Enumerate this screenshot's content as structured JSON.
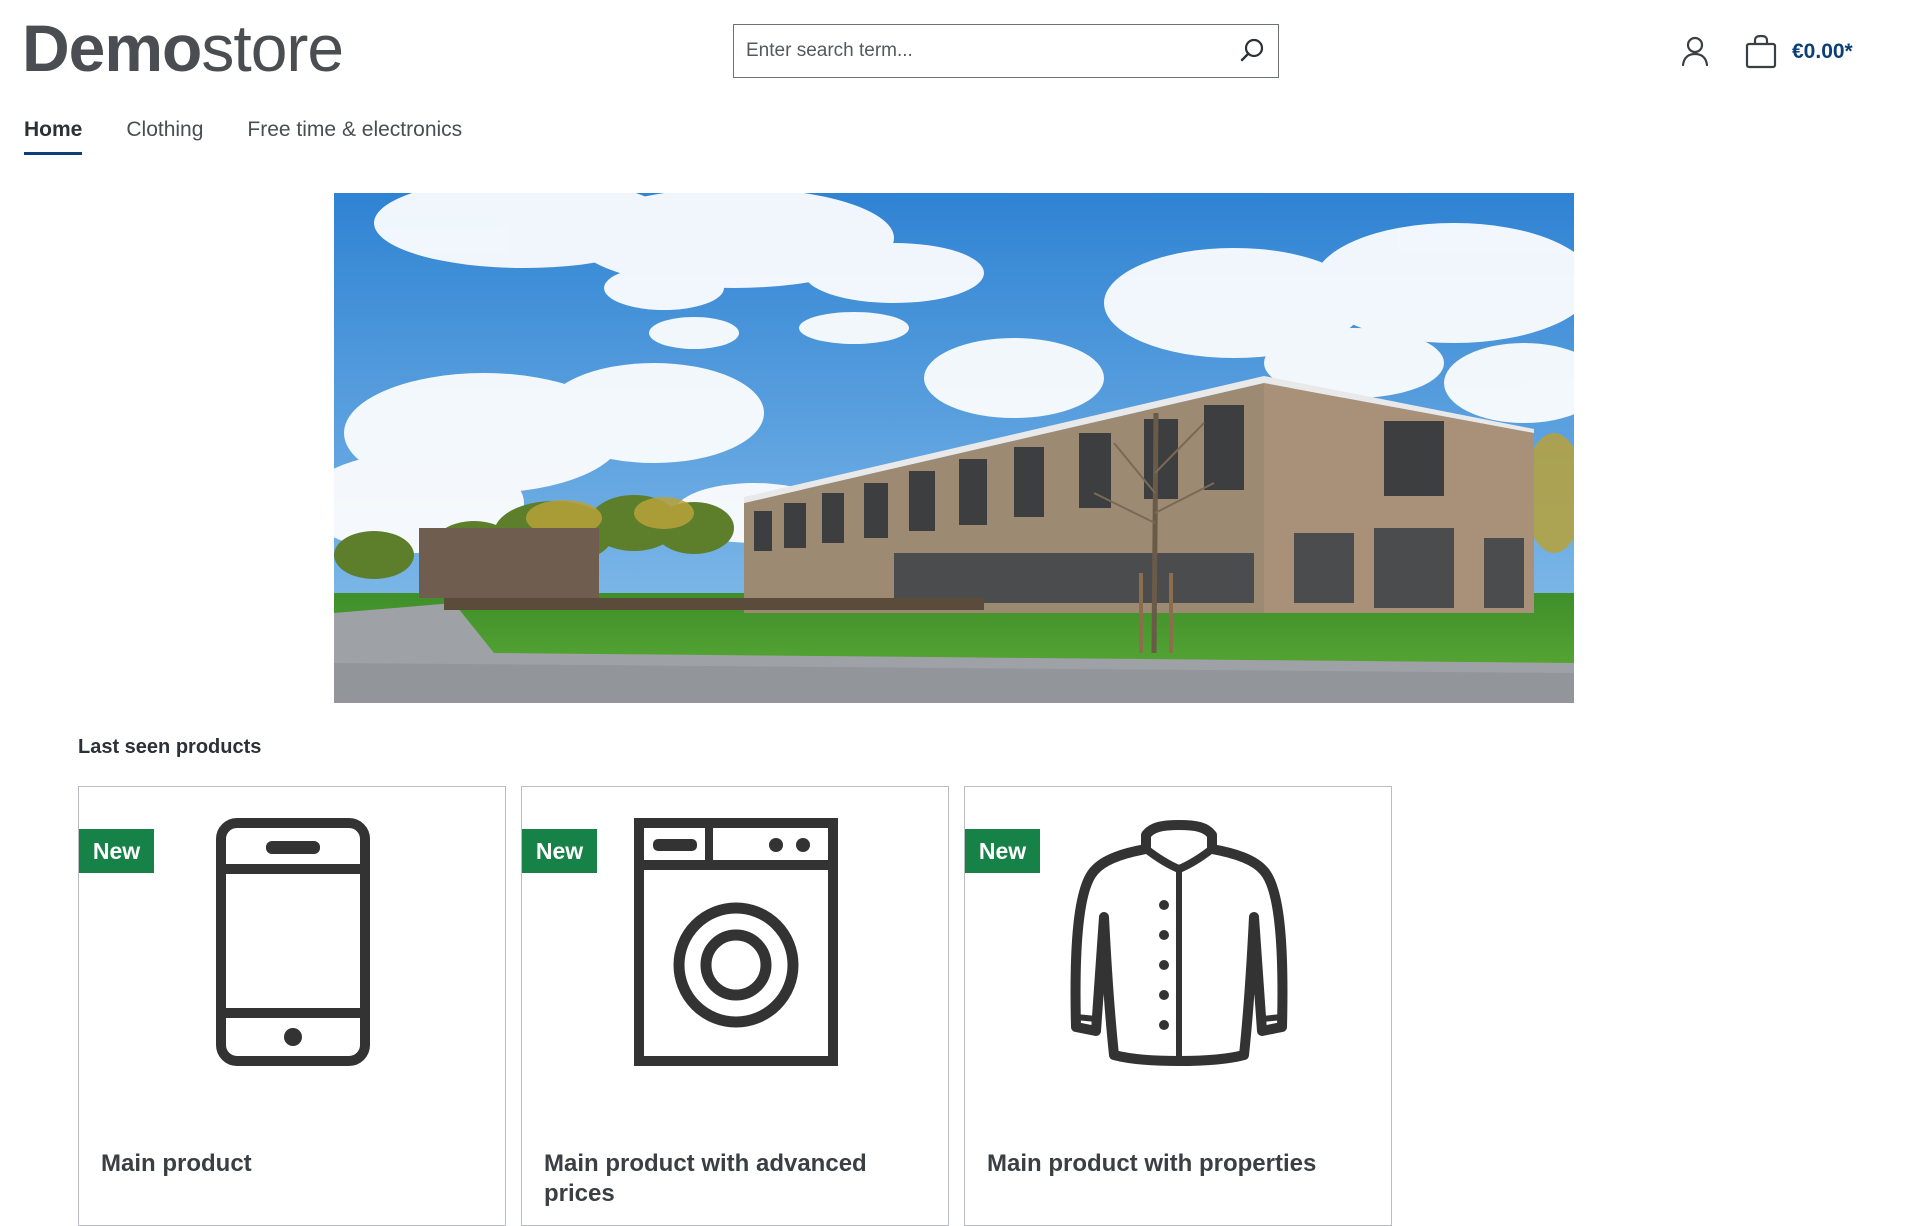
{
  "header": {
    "logo": {
      "strong": "Demo",
      "light": "store"
    },
    "search": {
      "placeholder": "Enter search term..."
    },
    "cart_total": "€0.00*"
  },
  "nav": {
    "items": [
      {
        "label": "Home",
        "active": true
      },
      {
        "label": "Clothing"
      },
      {
        "label": "Free time & electronics"
      }
    ]
  },
  "hero": {
    "icon": "building-photo"
  },
  "last_seen": {
    "title": "Last seen products",
    "products": [
      {
        "badge": "New",
        "name": "Main product",
        "icon": "smartphone-icon"
      },
      {
        "badge": "New",
        "name": "Main product with advanced prices",
        "icon": "washing-machine-icon"
      },
      {
        "badge": "New",
        "name": "Main product with properties",
        "icon": "jacket-icon"
      }
    ]
  },
  "colors": {
    "accent": "#0b3f7a",
    "badge": "#168247",
    "text": "#2b3136"
  }
}
